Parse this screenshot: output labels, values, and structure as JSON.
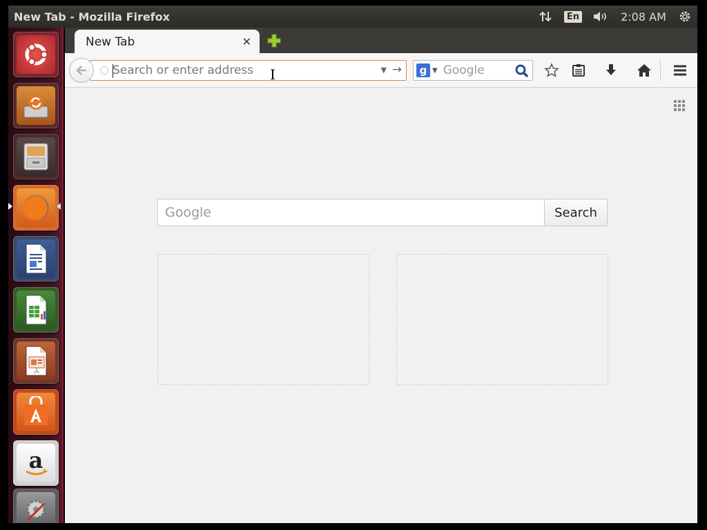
{
  "panel": {
    "window_title": "New Tab - Mozilla Firefox",
    "language": "En",
    "clock": "2:08 AM"
  },
  "launcher": {
    "items": [
      {
        "name": "dash-home",
        "icon": "ubuntu-logo-icon"
      },
      {
        "name": "system-updater",
        "icon": "software-updater-icon"
      },
      {
        "name": "files",
        "icon": "file-cabinet-icon"
      },
      {
        "name": "firefox",
        "icon": "firefox-icon",
        "active": true
      },
      {
        "name": "libreoffice-writer",
        "icon": "writer-icon"
      },
      {
        "name": "libreoffice-calc",
        "icon": "calc-icon"
      },
      {
        "name": "libreoffice-impress",
        "icon": "impress-icon"
      },
      {
        "name": "ubuntu-software-center",
        "icon": "software-center-icon"
      },
      {
        "name": "amazon",
        "icon": "amazon-icon"
      },
      {
        "name": "system-settings",
        "icon": "settings-icon"
      }
    ]
  },
  "browser": {
    "tab_title": "New Tab",
    "url_placeholder": "Search or enter address",
    "search_engine": "Google",
    "search_placeholder": "Google"
  },
  "newtab": {
    "search_placeholder": "Google",
    "search_button": "Search"
  },
  "colors": {
    "panel_bg": "#3c3b37",
    "launcher_bg": "#3e1220",
    "urlbar_focus": "#e9813b",
    "content_bg": "#f1f1f1"
  }
}
